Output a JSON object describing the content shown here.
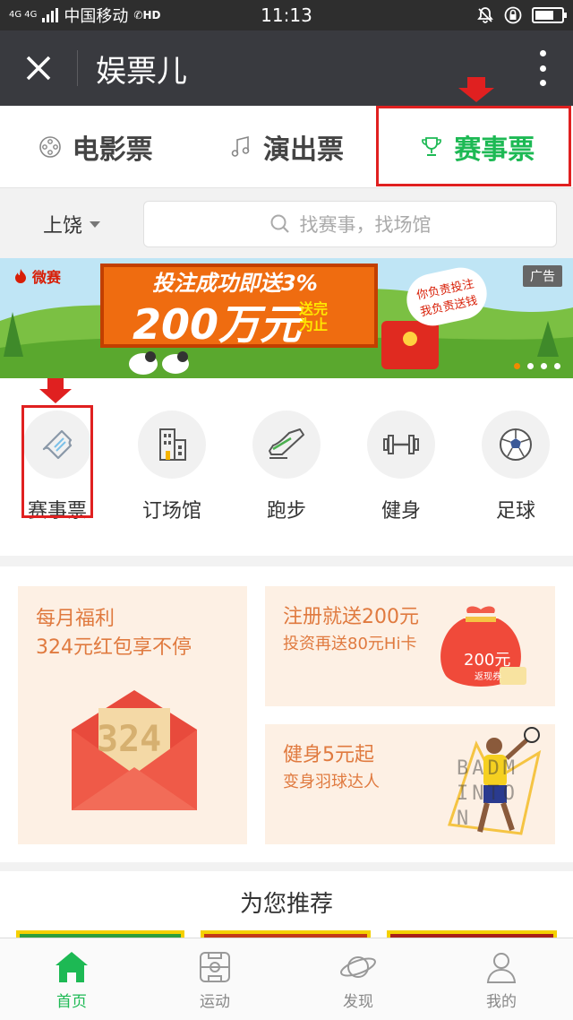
{
  "status_bar": {
    "network": "4G 4G",
    "carrier": "中国移动",
    "hd": "HD",
    "time": "11:13",
    "battery_level": 0.72
  },
  "titlebar": {
    "title": "娱票儿",
    "close_icon": "close-icon",
    "menu_icon": "more-vertical-icon"
  },
  "tabs": [
    {
      "label": "电影票",
      "icon": "film-reel-icon",
      "active": false
    },
    {
      "label": "演出票",
      "icon": "music-note-icon",
      "active": false
    },
    {
      "label": "赛事票",
      "icon": "trophy-icon",
      "active": true
    }
  ],
  "search": {
    "city": "上饶",
    "placeholder": "找赛事，找场馆"
  },
  "banner": {
    "logo_text": "微赛",
    "line1": "投注成功即送3%",
    "line2": "200万元",
    "line3": "送完为止",
    "bubble": "你负责投注 我负责送钱",
    "ad_tag": "广告",
    "slides": 4,
    "current_slide": 1
  },
  "grid": [
    {
      "label": "赛事票",
      "icon": "ticket-icon"
    },
    {
      "label": "订场馆",
      "icon": "building-icon"
    },
    {
      "label": "跑步",
      "icon": "sneaker-icon"
    },
    {
      "label": "健身",
      "icon": "dumbbell-icon"
    },
    {
      "label": "足球",
      "icon": "soccer-ball-icon"
    }
  ],
  "promos": {
    "monthly": {
      "title": "每月福利",
      "subtitle": "324元红包享不停",
      "envelope_number": "324"
    },
    "register": {
      "title": "注册就送200元",
      "subtitle": "投资再送80元Hi卡",
      "bag_amount": "200元",
      "bag_caption": "返现券"
    },
    "fitness": {
      "title": "健身5元起",
      "subtitle": "变身羽球达人",
      "art_text": "BADMINTON"
    }
  },
  "recommend": {
    "title": "为您推荐"
  },
  "bottom_nav": [
    {
      "label": "首页",
      "icon": "home-icon",
      "active": true
    },
    {
      "label": "运动",
      "icon": "field-icon",
      "active": false
    },
    {
      "label": "发现",
      "icon": "planet-icon",
      "active": false
    },
    {
      "label": "我的",
      "icon": "user-icon",
      "active": false
    }
  ],
  "colors": {
    "accent": "#1db954",
    "highlight": "#e02020",
    "promo_text": "#e07a3f"
  }
}
